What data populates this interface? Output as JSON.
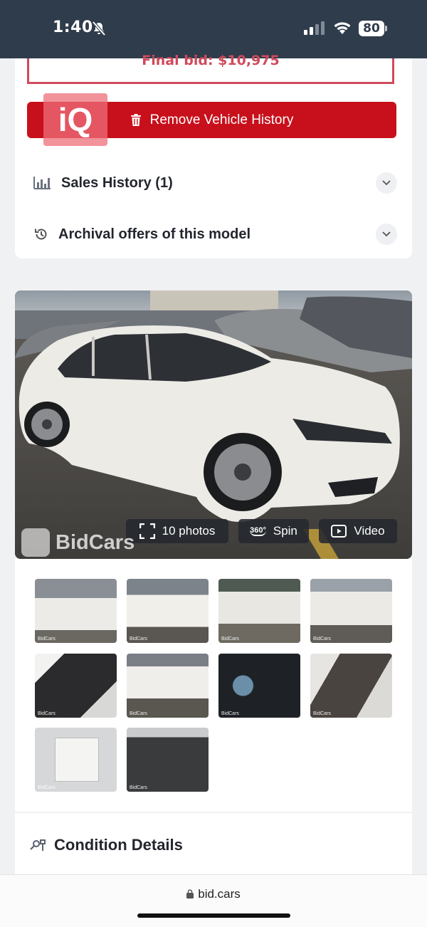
{
  "status_bar": {
    "time": "1:40",
    "battery": "80"
  },
  "vehicle": {
    "final_bid": "Final bid: $10,975",
    "remove_history_label": "Remove Vehicle History",
    "iq_logo_text": "iQ"
  },
  "sections": {
    "sales_history": "Sales History (1)",
    "archival_offers": "Archival offers of this model"
  },
  "media": {
    "photos_label": "10 photos",
    "spin_badge": "360°",
    "spin_label": "Spin",
    "video_label": "Video",
    "watermark": "BidCars",
    "thumb_watermark": "BidCars"
  },
  "condition": {
    "title": "Condition Details"
  },
  "browser": {
    "url": "bid.cars"
  },
  "colors": {
    "accent_red": "#c8101c",
    "status_bar": "#2f3c4b",
    "bid_border": "#d04a5c"
  }
}
